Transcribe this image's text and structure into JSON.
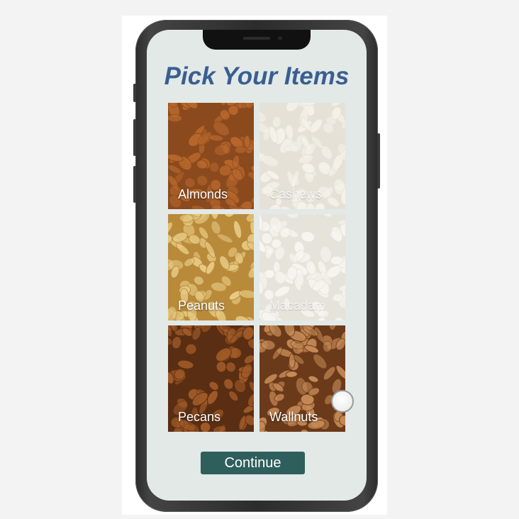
{
  "screen": {
    "title": "Pick Your Items",
    "items": [
      {
        "label": "Almonds",
        "selected": true,
        "base_color": "#8a4a1e",
        "grain_color": "#b8672c"
      },
      {
        "label": "Cashews",
        "selected": false,
        "base_color": "#d8d2c2",
        "grain_color": "#f1ece0"
      },
      {
        "label": "Peanuts",
        "selected": true,
        "base_color": "#b88a3a",
        "grain_color": "#e7c982"
      },
      {
        "label": "Macadam",
        "selected": false,
        "base_color": "#d9d5c8",
        "grain_color": "#f4f1e8"
      },
      {
        "label": "Pecans",
        "selected": true,
        "base_color": "#5a2e12",
        "grain_color": "#a05a28"
      },
      {
        "label": "Wallnuts",
        "selected": true,
        "base_color": "#6b3a1a",
        "grain_color": "#c58a55"
      }
    ],
    "continue_label": "Continue"
  },
  "colors": {
    "title": "#3a5e91",
    "screen_background": "#e2e9e7",
    "button": "#2f5f5d"
  }
}
